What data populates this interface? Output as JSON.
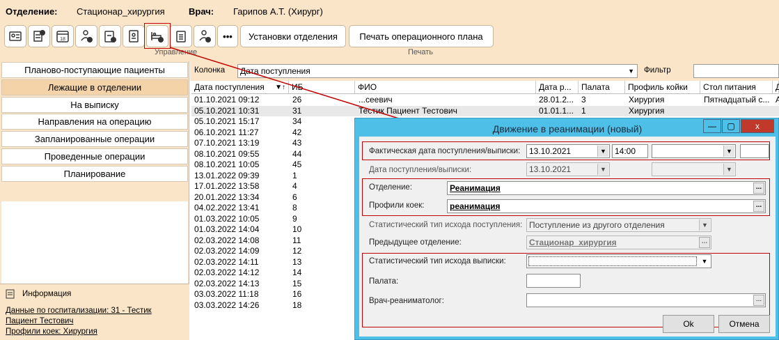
{
  "header": {
    "dept_label": "Отделение:",
    "dept_value": "Стационар_хирургия",
    "doctor_label": "Врач:",
    "doctor_value": "Гарипов А.Т. (Хирург)"
  },
  "toolbar": {
    "icons": [
      "patient-card-icon",
      "patient-transfer-icon",
      "calendar-18-icon",
      "doctor-download-icon",
      "clipboard-download-icon",
      "badge-icon",
      "bed-transfer-icon",
      "clipboard-icon",
      "user-transfer-icon"
    ],
    "calendar_day": "18",
    "more": "•••",
    "ward_settings": "Установки отделения",
    "print_plan": "Печать операционного плана",
    "group_manage": "Управление",
    "group_print": "Печать"
  },
  "nav": {
    "items": [
      "Планово-поступающие пациенты",
      "Лежащие в отделении",
      "На выписку",
      "Направления на операцию",
      "Запланированные операции",
      "Проведенные операции",
      "Планирование"
    ],
    "active": 1
  },
  "info": {
    "title": "Информация",
    "link1": "Данные по госпитализации: 31 - Тестик",
    "link2": "Пациент Тестович",
    "link3": "Профили коек: Хирургия"
  },
  "filterbar": {
    "column_label": "Колонка",
    "column_value": "Дата поступления",
    "filter_label": "Фильтр"
  },
  "table": {
    "headers": [
      "Дата поступления",
      "ИБ",
      "ФИО",
      "Дата р...",
      "Палата",
      "Профиль койки",
      "Стол питания",
      "Д"
    ],
    "rows": [
      [
        "01.10.2021 09:12",
        "26",
        "...сеевич",
        "28.01.2...",
        "3",
        "Хирургия",
        "Пятнадцатый с...",
        "А"
      ],
      [
        "05.10.2021 10:31",
        "31",
        "Тестик Пациент Тестович",
        "01.01.1...",
        "1",
        "Хирургия",
        "",
        ""
      ],
      [
        "05.10.2021 15:17",
        "34",
        "",
        "",
        "",
        "",
        "",
        ""
      ],
      [
        "06.10.2021 11:27",
        "42",
        "",
        "",
        "",
        "",
        "",
        ""
      ],
      [
        "07.10.2021 13:19",
        "43",
        "",
        "",
        "",
        "",
        "",
        ""
      ],
      [
        "08.10.2021 09:55",
        "44",
        "",
        "",
        "",
        "",
        "",
        ""
      ],
      [
        "08.10.2021 10:05",
        "45",
        "",
        "",
        "",
        "",
        "",
        ""
      ],
      [
        "13.01.2022 09:39",
        "1",
        "",
        "",
        "",
        "",
        "",
        ""
      ],
      [
        "17.01.2022 13:58",
        "4",
        "",
        "",
        "",
        "",
        "",
        ""
      ],
      [
        "20.01.2022 13:34",
        "6",
        "",
        "",
        "",
        "",
        "",
        ""
      ],
      [
        "04.02.2022 13:41",
        "8",
        "",
        "",
        "",
        "",
        "",
        ""
      ],
      [
        "01.03.2022 10:05",
        "9",
        "",
        "",
        "",
        "",
        "",
        ""
      ],
      [
        "01.03.2022 14:04",
        "10",
        "",
        "",
        "",
        "",
        "",
        ""
      ],
      [
        "02.03.2022 14:08",
        "11",
        "",
        "",
        "",
        "",
        "",
        ""
      ],
      [
        "02.03.2022 14:09",
        "12",
        "",
        "",
        "",
        "",
        "",
        ""
      ],
      [
        "02.03.2022 14:11",
        "13",
        "",
        "",
        "",
        "",
        "",
        ""
      ],
      [
        "02.03.2022 14:12",
        "14",
        "",
        "",
        "",
        "",
        "",
        ""
      ],
      [
        "02.03.2022 14:13",
        "15",
        "",
        "",
        "",
        "",
        "",
        ""
      ],
      [
        "03.03.2022 11:18",
        "16",
        "",
        "",
        "",
        "",
        "",
        ""
      ],
      [
        "03.03.2022 14:26",
        "18",
        "",
        "",
        "",
        "",
        "",
        ""
      ]
    ],
    "selected_row": 1
  },
  "dialog": {
    "title": "Движение в реанимации (новый)",
    "minimize": "—",
    "maximize": "▢",
    "close": "x",
    "fact_date_label": "Фактическая дата поступления/выписки:",
    "fact_date": "13.10.2021",
    "fact_time": "14:00",
    "date_label": "Дата поступления/выписки:",
    "date_value": "13.10.2021",
    "dept_label": "Отделение:",
    "dept_value": "Реанимация",
    "bed_label": "Профили коек:",
    "bed_value": "реанимация",
    "stat_in_label": "Статистический тип исхода поступления:",
    "stat_in_value": "Поступление из другого отделения",
    "prev_dept_label": "Предыдущее отделение:",
    "prev_dept_value": "Стационар_хирургия",
    "stat_out_label": "Статистический тип исхода выписки:",
    "ward_label": "Палата:",
    "resus_label": "Врач-реаниматолог:",
    "ok": "Ok",
    "cancel": "Отмена"
  },
  "colors": {
    "accent_red": "#c00000",
    "dialog_frame": "#4ec0e8",
    "panel_bg": "#fbe5c8"
  }
}
